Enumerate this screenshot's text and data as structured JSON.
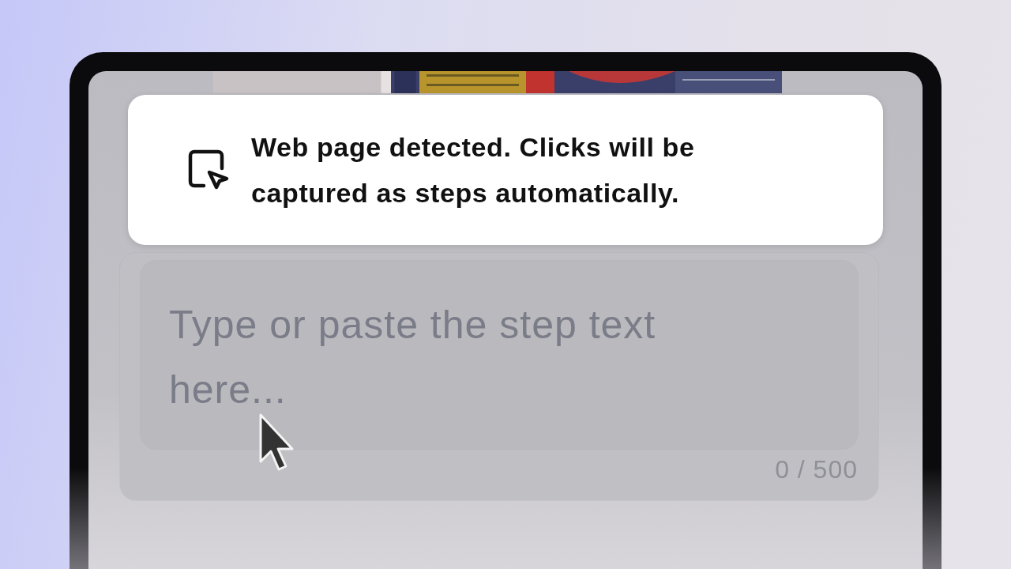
{
  "toast": {
    "message": "Web page detected. Clicks will be captured as steps automatically."
  },
  "step_input": {
    "placeholder": "Type or paste the step text here...",
    "counter": "0 / 500"
  }
}
